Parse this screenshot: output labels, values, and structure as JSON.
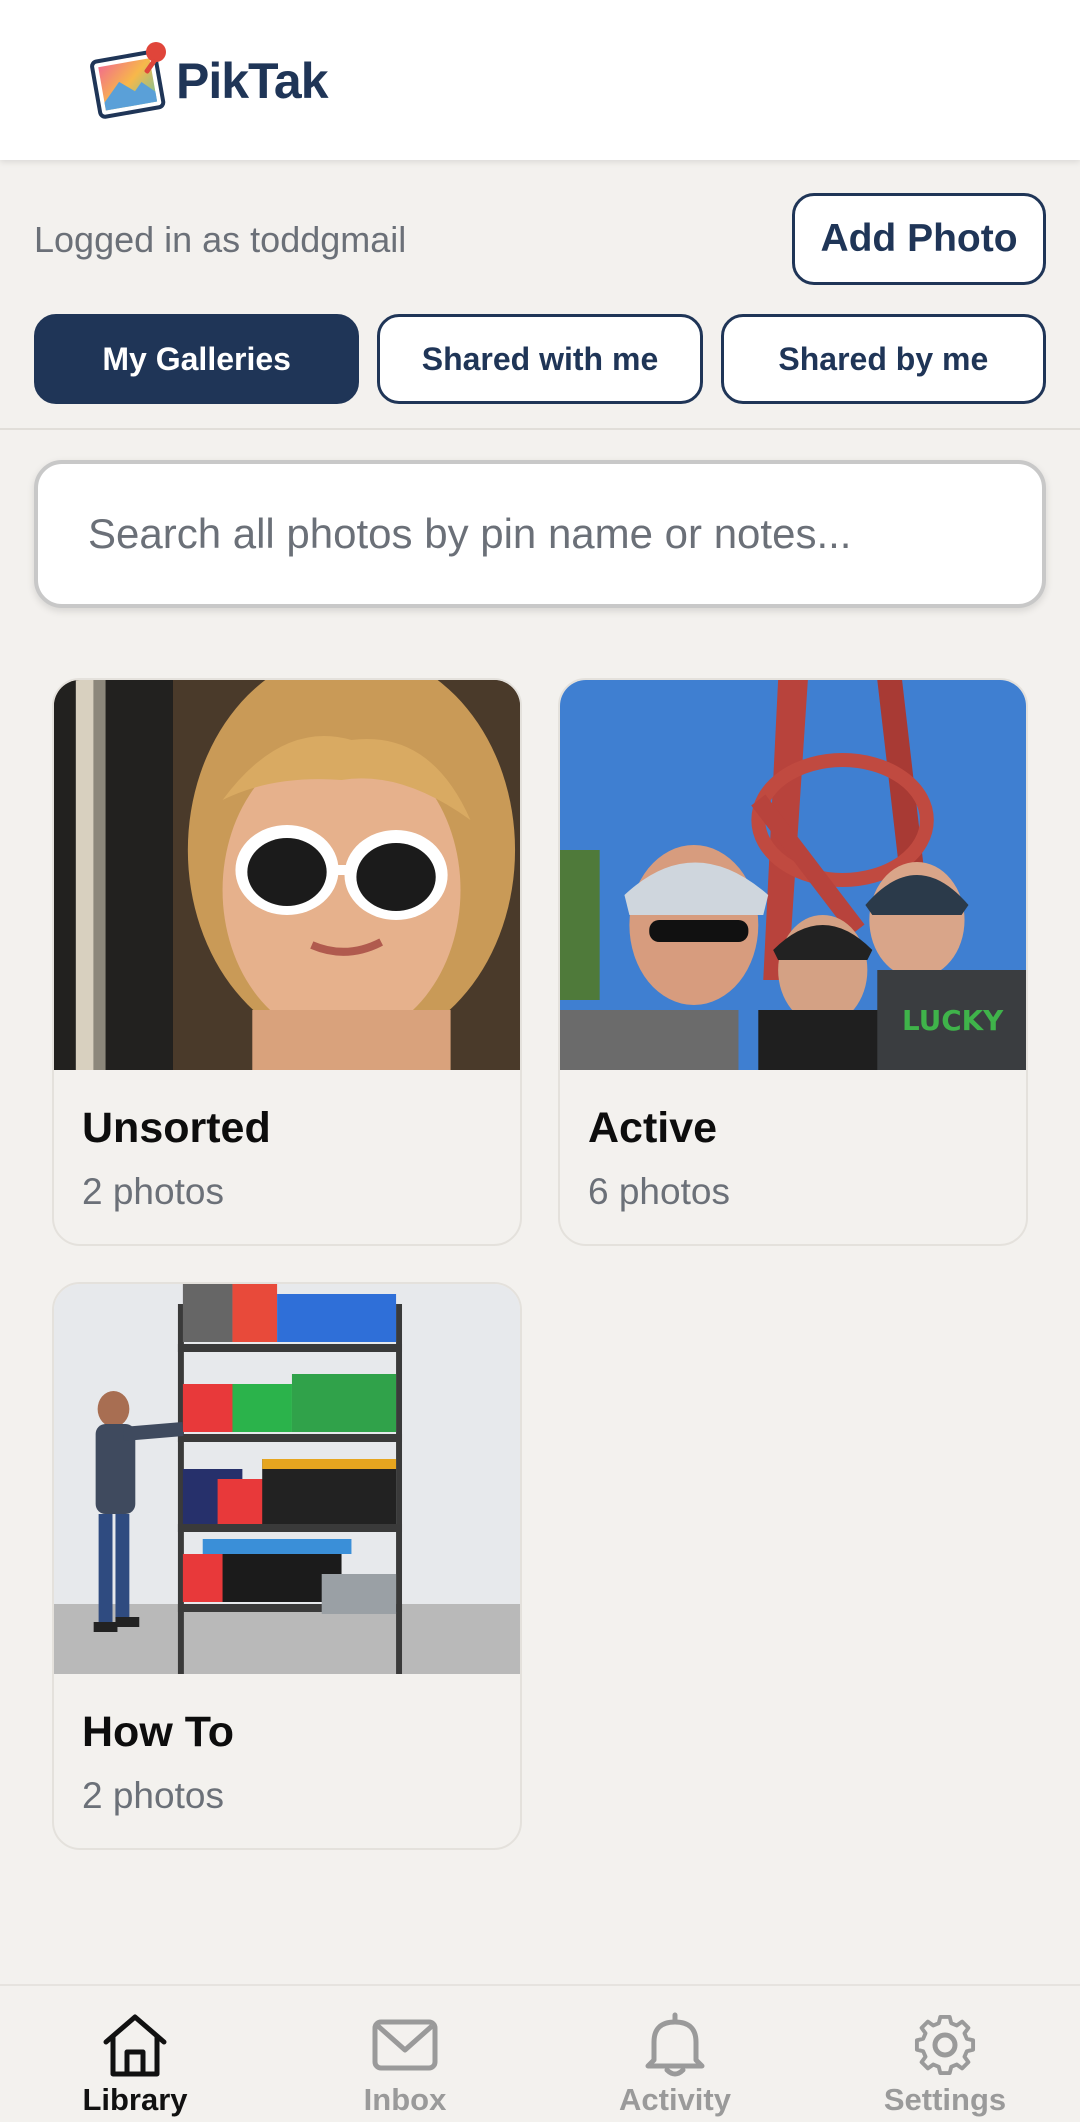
{
  "app": {
    "name": "PikTak"
  },
  "account": {
    "logged_in_text": "Logged in as toddgmail"
  },
  "actions": {
    "add_photo": "Add Photo"
  },
  "tabs": [
    {
      "label": "My Galleries",
      "active": true
    },
    {
      "label": "Shared with me",
      "active": false
    },
    {
      "label": "Shared by me",
      "active": false
    }
  ],
  "search": {
    "placeholder": "Search all photos by pin name or notes...",
    "value": ""
  },
  "galleries": [
    {
      "title": "Unsorted",
      "count": "2 photos",
      "thumbnail": "girl-heart-sunglasses"
    },
    {
      "title": "Active",
      "count": "6 photos",
      "thumbnail": "cycling-selfie-red-sculpture"
    },
    {
      "title": "How To",
      "count": "2 photos",
      "thumbnail": "garage-storage-shelf"
    }
  ],
  "bottom_nav": [
    {
      "label": "Library",
      "icon": "home-icon",
      "active": true
    },
    {
      "label": "Inbox",
      "icon": "mail-icon",
      "active": false
    },
    {
      "label": "Activity",
      "icon": "bell-icon",
      "active": false
    },
    {
      "label": "Settings",
      "icon": "gear-icon",
      "active": false
    }
  ],
  "colors": {
    "primary": "#1f3557",
    "background": "#f3f1ee",
    "muted_text": "#6b7078"
  }
}
